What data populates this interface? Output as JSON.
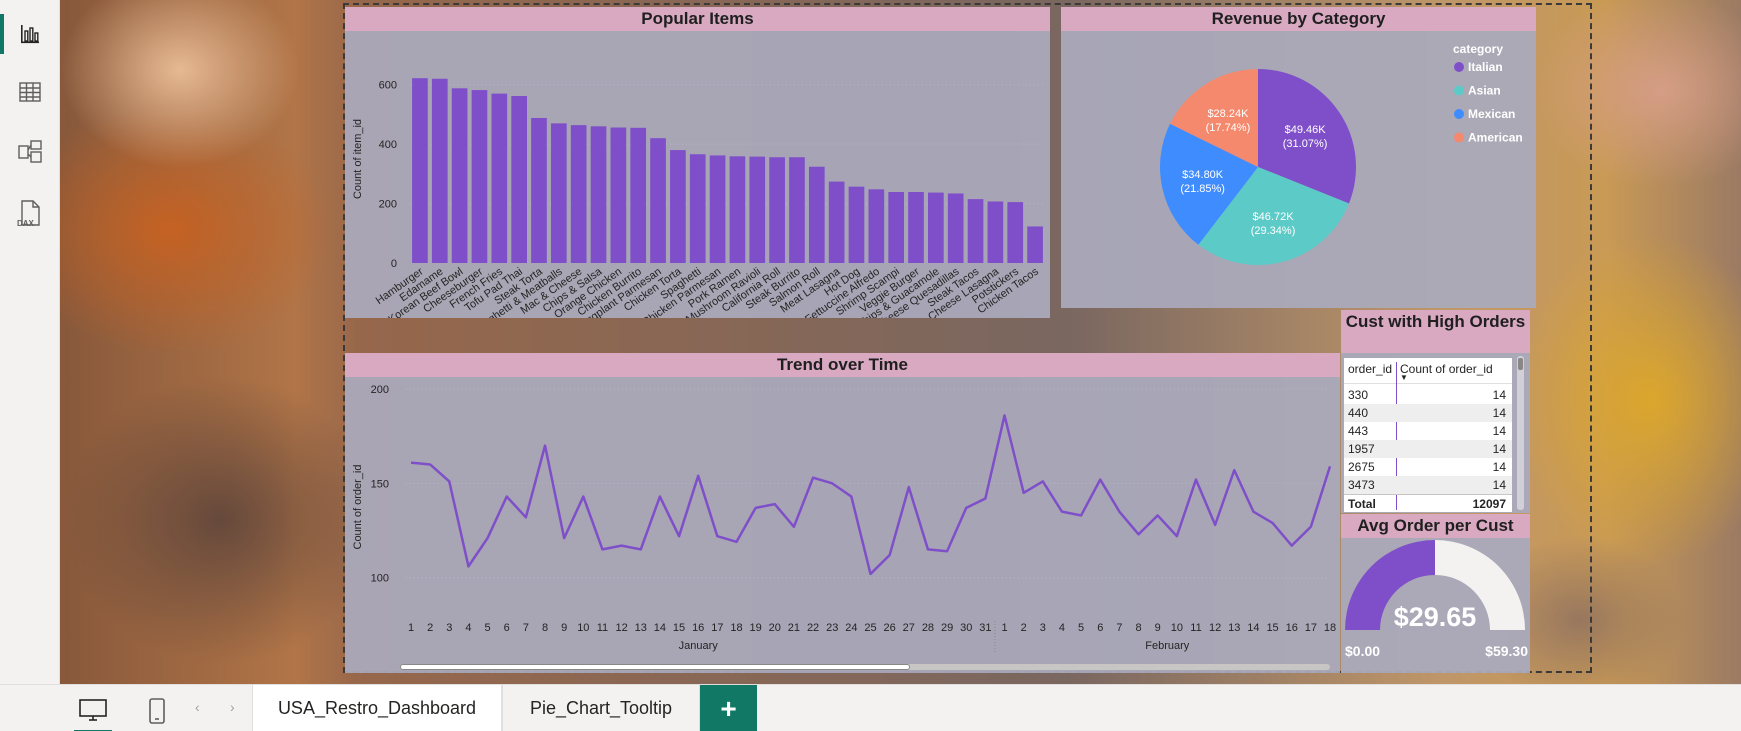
{
  "sidebar": {
    "items": [
      {
        "name": "report-view-icon"
      },
      {
        "name": "table-view-icon"
      },
      {
        "name": "model-view-icon"
      },
      {
        "name": "dax-query-view-icon",
        "label": "DAX"
      }
    ]
  },
  "tabs": [
    {
      "label": "USA_Restro_Dashboard",
      "active": true
    },
    {
      "label": "Pie_Chart_Tooltip",
      "active": false
    }
  ],
  "add_page_label": "+",
  "visuals": {
    "popular_items": {
      "title": "Popular Items"
    },
    "revenue": {
      "title": "Revenue by Category",
      "legend_title": "category"
    },
    "trend": {
      "title": "Trend over Time"
    },
    "cust_high": {
      "title": "Cust with High Orders",
      "headers": [
        "order_id",
        "Count of order_id"
      ],
      "rows": [
        [
          "330",
          "14"
        ],
        [
          "440",
          "14"
        ],
        [
          "443",
          "14"
        ],
        [
          "1957",
          "14"
        ],
        [
          "2675",
          "14"
        ],
        [
          "3473",
          "14"
        ]
      ],
      "total": [
        "Total",
        "12097"
      ]
    },
    "avg_order": {
      "title": "Avg Order per Cust",
      "value": "$29.65",
      "min": "$0.00",
      "max": "$59.30",
      "fraction": 0.5
    }
  },
  "colors": {
    "purple": "#7f4fc9",
    "teal": "#5ccbc7",
    "blue": "#3f8cff",
    "salmon": "#f4896d",
    "header_pink": "#d8a9c1",
    "accent_green": "#117865"
  },
  "chart_data": [
    {
      "type": "bar",
      "title": "Popular Items",
      "xlabel": "",
      "ylabel": "Count of item_id",
      "ylim": [
        0,
        700
      ],
      "yticks": [
        0,
        200,
        400,
        600
      ],
      "categories": [
        "Hamburger",
        "Edamame",
        "Korean Beef Bowl",
        "Cheeseburger",
        "French Fries",
        "Tofu Pad Thai",
        "Steak Torta",
        "Spaghetti & Meatballs",
        "Mac & Cheese",
        "Chips & Salsa",
        "Orange Chicken",
        "Chicken Burrito",
        "Eggplant Parmesan",
        "Chicken Torta",
        "Spaghetti",
        "Chicken Parmesan",
        "Pork Ramen",
        "Mushroom Ravioli",
        "California Roll",
        "Steak Burrito",
        "Salmon Roll",
        "Meat Lasagna",
        "Hot Dog",
        "Fettuccine Alfredo",
        "Shrimp Scampi",
        "Veggie Burger",
        "Chips & Guacamole",
        "Cheese Quesadillas",
        "Steak Tacos",
        "Cheese Lasagna",
        "Potstickers",
        "Chicken Tacos"
      ],
      "values": [
        622,
        620,
        588,
        582,
        570,
        562,
        488,
        470,
        464,
        460,
        456,
        455,
        420,
        380,
        366,
        362,
        359,
        358,
        356,
        356,
        324,
        274,
        257,
        248,
        239,
        239,
        237,
        234,
        215,
        207,
        205,
        123
      ]
    },
    {
      "type": "pie",
      "title": "Revenue by Category",
      "legend_title": "category",
      "slices": [
        {
          "label": "Italian",
          "value": 49.46,
          "display": "$49.46K",
          "pct": "(31.07%)",
          "color": "#7f4fc9"
        },
        {
          "label": "Asian",
          "value": 46.72,
          "display": "$46.72K",
          "pct": "(29.34%)",
          "color": "#5ccbc7"
        },
        {
          "label": "Mexican",
          "value": 34.8,
          "display": "$34.80K",
          "pct": "(21.85%)",
          "color": "#3f8cff"
        },
        {
          "label": "American",
          "value": 28.24,
          "display": "$28.24K",
          "pct": "(17.74%)",
          "color": "#f4896d"
        }
      ]
    },
    {
      "type": "line",
      "title": "Trend over Time",
      "xlabel": "",
      "ylabel": "Count of order_id",
      "yticks": [
        100,
        150,
        200
      ],
      "ylim": [
        76,
        200
      ],
      "months": [
        {
          "label": "January",
          "days": [
            "1",
            "2",
            "3",
            "4",
            "5",
            "6",
            "7",
            "8",
            "9",
            "10",
            "11",
            "12",
            "13",
            "14",
            "15",
            "16",
            "17",
            "18",
            "19",
            "20",
            "21",
            "22",
            "23",
            "24",
            "25",
            "26",
            "27",
            "28",
            "29",
            "30",
            "31"
          ]
        },
        {
          "label": "February",
          "days": [
            "1",
            "2",
            "3",
            "4",
            "5",
            "6",
            "7",
            "8",
            "9",
            "10",
            "11",
            "12",
            "13",
            "14",
            "15",
            "16",
            "17",
            "18"
          ]
        }
      ],
      "values": [
        161,
        160,
        151,
        106,
        121,
        143,
        132,
        170,
        121,
        143,
        115,
        117,
        115,
        143,
        122,
        154,
        122,
        119,
        137,
        139,
        127,
        153,
        150,
        143,
        102,
        112,
        148,
        115,
        114,
        137,
        142,
        186,
        145,
        151,
        135,
        133,
        152,
        135,
        123,
        133,
        122,
        152,
        128,
        157,
        135,
        129,
        117,
        127,
        159
      ]
    }
  ]
}
